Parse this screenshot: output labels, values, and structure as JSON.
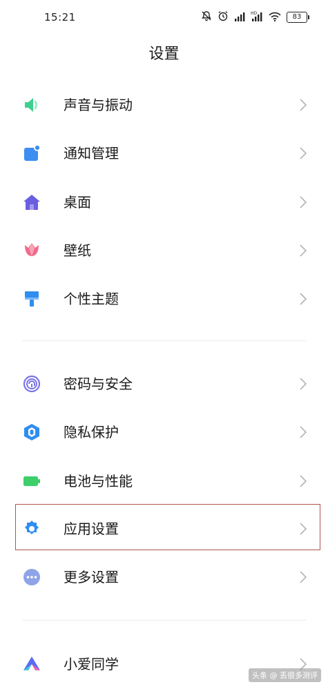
{
  "status_bar": {
    "time": "15:21",
    "icons": [
      "mute-bell-icon",
      "alarm-icon",
      "signal-icon",
      "hd-signal-icon",
      "wifi-icon",
      "battery-icon"
    ],
    "hd_label": "HD",
    "battery": "83"
  },
  "header": {
    "title": "设置"
  },
  "groups": [
    {
      "items": [
        {
          "label": "声音与振动",
          "icon": "speaker-icon",
          "color": "#3ecf8e"
        },
        {
          "label": "通知管理",
          "icon": "notification-icon",
          "color": "#3d8ef0"
        },
        {
          "label": "桌面",
          "icon": "home-icon",
          "color": "#6a5fe0"
        },
        {
          "label": "壁纸",
          "icon": "tulip-icon",
          "color": "#ef6b8a"
        },
        {
          "label": "个性主题",
          "icon": "brush-icon",
          "color": "#2f8ef0"
        }
      ]
    },
    {
      "items": [
        {
          "label": "密码与安全",
          "icon": "fingerprint-icon",
          "color": "#7a73e8"
        },
        {
          "label": "隐私保护",
          "icon": "privacy-shield-icon",
          "color": "#2f8ef0"
        },
        {
          "label": "电池与性能",
          "icon": "battery-performance-icon",
          "color": "#3ecf6a"
        },
        {
          "label": "应用设置",
          "icon": "gear-icon",
          "color": "#2f8ef0",
          "highlighted": true
        },
        {
          "label": "更多设置",
          "icon": "more-dots-icon",
          "color": "#8fa4e8"
        }
      ]
    },
    {
      "items": [
        {
          "label": "小爱同学",
          "icon": "xiaoai-icon",
          "color": "#5a6cf0"
        }
      ]
    }
  ],
  "watermark": "头条 @ 丢很多测评"
}
